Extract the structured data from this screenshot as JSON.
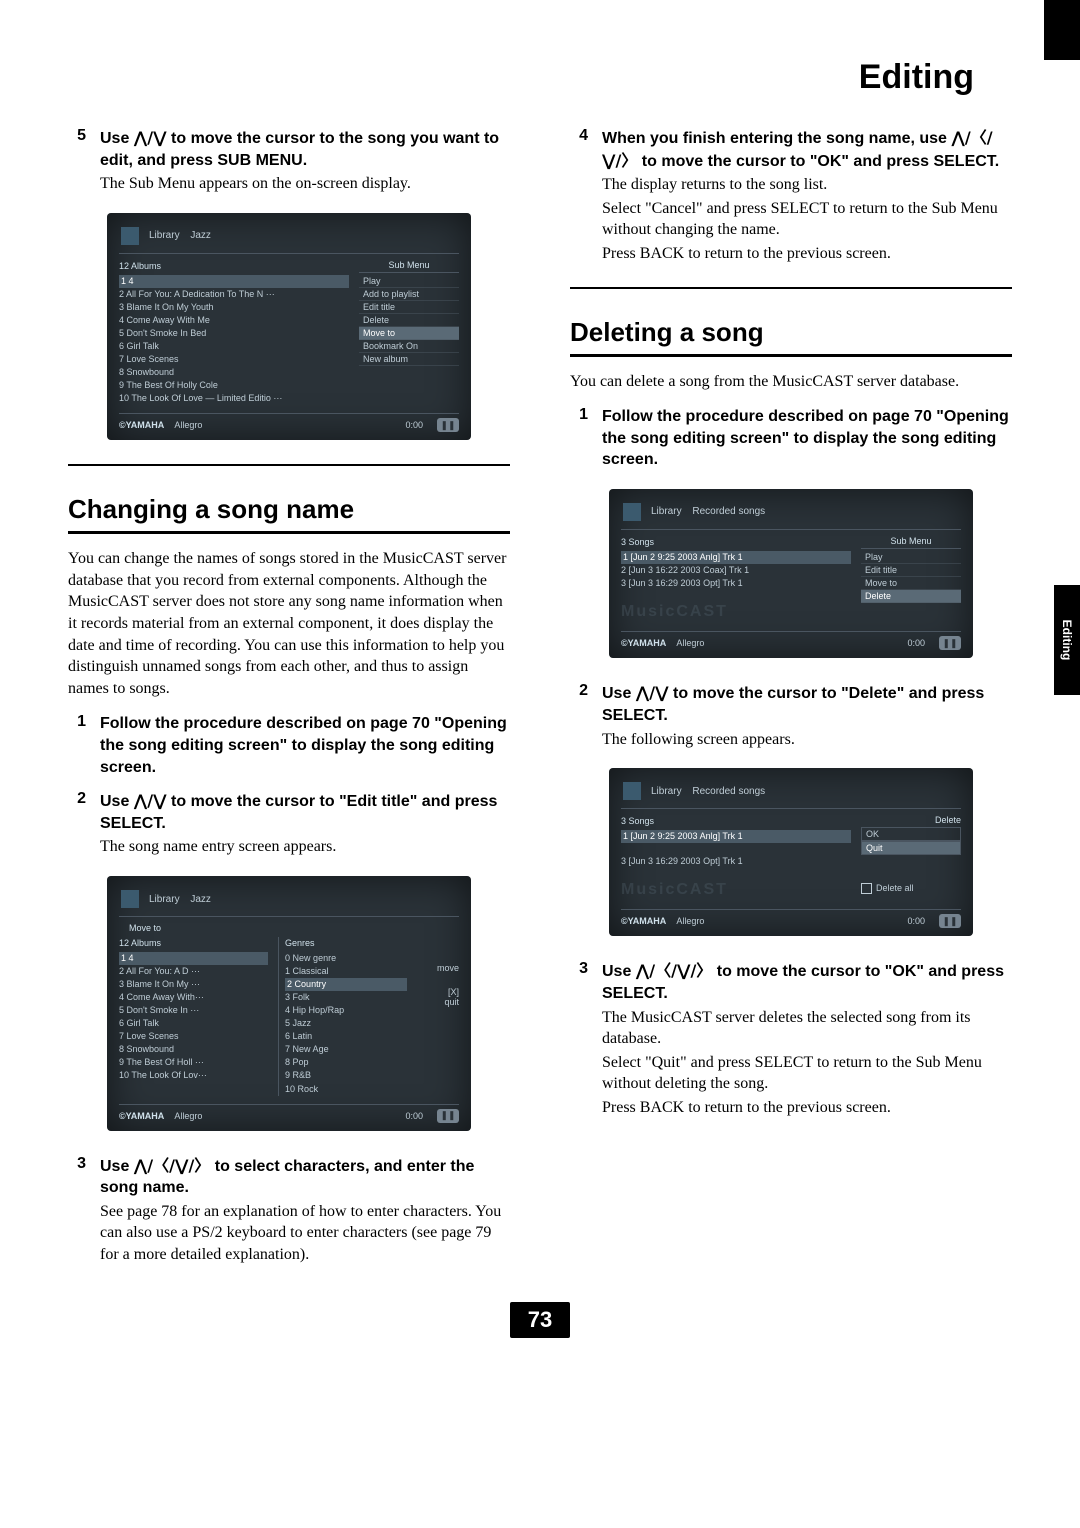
{
  "page_title": "Editing",
  "side_tab": "Editing",
  "page_number": "73",
  "arrows_ud": "⋀/⋁",
  "arrows_all": "⋀/〈/⋁/〉",
  "left": {
    "step5": {
      "num": "5",
      "bold_a": "Use ",
      "bold_b": " to move the cursor to the song you want to edit, and press SUB MENU.",
      "note": "The Sub Menu appears on the on-screen display."
    },
    "ss1": {
      "bc1": "Library",
      "bc2": "Jazz",
      "list_title": "12  Albums",
      "rows": [
        "1  4",
        "2  All For You: A Dedication To The N ···",
        "3  Blame It On My Youth",
        "4  Come Away With Me",
        "5  Don't Smoke In Bed",
        "6  Girl Talk",
        "7  Love Scenes",
        "8  Snowbound",
        "9  The Best Of Holly Cole",
        "10  The Look Of Love — Limited Editio ···"
      ],
      "submenu_title": "Sub Menu",
      "submenu": [
        "Play",
        "Add to playlist",
        "Edit title",
        "Delete",
        "Move to",
        "Bookmark On",
        "New album"
      ],
      "brand": "©YAMAHA",
      "track": "Allegro",
      "time": "0:00"
    },
    "h_change": "Changing a song name",
    "p_change": "You can change the names of songs stored in the MusicCAST server database that you record from external components. Although the MusicCAST server does not store any song name information when it records material from an external component, it does display the date and time of recording. You can use this information to help you distinguish unnamed songs from each other, and thus to assign names to songs.",
    "step1c": {
      "num": "1",
      "bold": "Follow the procedure described on page 70 \"Opening the song editing screen\" to display the song editing screen."
    },
    "step2c": {
      "num": "2",
      "bold_a": "Use ",
      "bold_b": " to move the cursor to \"Edit title\" and press SELECT.",
      "note": "The song name entry screen appears."
    },
    "ss2": {
      "bc1": "Library",
      "bc2": "Jazz",
      "moveto": "Move to",
      "list_title_l": "12  Albums",
      "rows_l": [
        "1  4",
        "2  All For You: A D ···",
        "3  Blame It On My ···",
        "4  Come Away With···",
        "5  Don't Smoke In ···",
        "6  Girl Talk",
        "7  Love Scenes",
        "8  Snowbound",
        "9  The Best Of Holl ···",
        "10  The Look Of Lov···"
      ],
      "list_title_r": "Genres",
      "rows_r": [
        "0  New genre",
        "1  Classical",
        "2  Country",
        "3  Folk",
        "4  Hip Hop/Rap",
        "5  Jazz",
        "6  Latin",
        "7  New Age",
        "8  Pop",
        "9  R&B",
        "10  Rock"
      ],
      "side": [
        "move",
        "[X]",
        "quit"
      ],
      "brand": "©YAMAHA",
      "track": "Allegro",
      "time": "0:00"
    },
    "step3c": {
      "num": "3",
      "bold_a": "Use ",
      "bold_b": " to select characters, and enter the song name.",
      "note": "See page 78 for an explanation of how to enter characters. You can also use a PS/2 keyboard to enter characters (see page 79 for a more detailed explanation)."
    }
  },
  "right": {
    "step4": {
      "num": "4",
      "bold_a": "When you finish entering the song name, use ",
      "bold_b": " to move the cursor to \"OK\" and press SELECT.",
      "note1": "The display returns to the song list.",
      "note2": "Select \"Cancel\" and press SELECT to return to the Sub Menu without changing the name.",
      "note3": "Press BACK to return to the previous screen."
    },
    "h_delete": "Deleting a song",
    "p_delete": "You can delete a song from the MusicCAST server database.",
    "step1d": {
      "num": "1",
      "bold": "Follow the procedure described on page 70 \"Opening the song editing screen\" to display the song editing screen."
    },
    "ss3": {
      "bc1": "Library",
      "bc2": "Recorded songs",
      "list_title": "3  Songs",
      "rows": [
        "1  [Jun  2  9:25 2003 Anlg] Trk 1",
        "2  [Jun  3 16:22 2003 Coax] Trk 1",
        "3  [Jun  3 16:29 2003 Opt] Trk 1"
      ],
      "submenu_title": "Sub Menu",
      "submenu": [
        "Play",
        "Edit title",
        "Move to",
        "Delete"
      ],
      "ghost": "MusicCAST",
      "brand": "©YAMAHA",
      "track": "Allegro",
      "time": "0:00"
    },
    "step2d": {
      "num": "2",
      "bold_a": "Use ",
      "bold_b": " to move the cursor to \"Delete\" and press SELECT.",
      "note": "The following screen appears."
    },
    "ss4": {
      "bc1": "Library",
      "bc2": "Recorded songs",
      "list_title": "3  Songs",
      "rows": [
        "1  [Jun  2  9:25 2003 Anlg] Trk 1",
        "",
        "3  [Jun  3 16:29 2003 Opt] Trk 1"
      ],
      "panel_title": "Delete",
      "panel_items": [
        "OK",
        "Quit"
      ],
      "panel_check": "Delete all",
      "ghost": "MusicCAST",
      "brand": "©YAMAHA",
      "track": "Allegro",
      "time": "0:00"
    },
    "step3d": {
      "num": "3",
      "bold_a": "Use ",
      "bold_b": " to move the cursor to \"OK\" and press SELECT.",
      "note1": "The MusicCAST server deletes the selected song from its database.",
      "note2": "Select \"Quit\" and press SELECT to return to the Sub Menu without deleting the song.",
      "note3": "Press BACK to return to the previous screen."
    }
  }
}
